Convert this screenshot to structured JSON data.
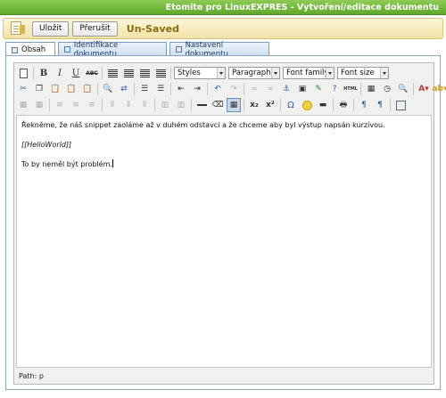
{
  "window": {
    "title": "Etomite pro LinuxEXPRES - Vytvoření/editace dokumentu"
  },
  "actions": {
    "save_label": "Uložit",
    "cancel_label": "Přerušit",
    "status": "Un-Saved"
  },
  "tabs": [
    {
      "label": "Obsah",
      "active": true
    },
    {
      "label": "Identifikace dokumentu",
      "active": false
    },
    {
      "label": "Nastavení dokumentu",
      "active": false
    }
  ],
  "toolbar": {
    "styles_select": "Styles",
    "format_select": "Paragraph",
    "font_family_select": "Font family",
    "font_size_select": "Font size",
    "html_button": "HTML"
  },
  "content": {
    "paragraphs": [
      "Řekněme, že náš snippet zaoláme až v duhém odstavci a že chceme aby byl výstup napsán kurzívou.",
      "[[HelloWorld]]",
      "To by neměl být problém."
    ]
  },
  "statusbar": {
    "path": "Path: p"
  },
  "colors": {
    "titlebar": "#6fb83a",
    "actionbar": "#f6ebc0",
    "unsaved": "#8a6d10",
    "tab_border": "#7b9ebd"
  }
}
